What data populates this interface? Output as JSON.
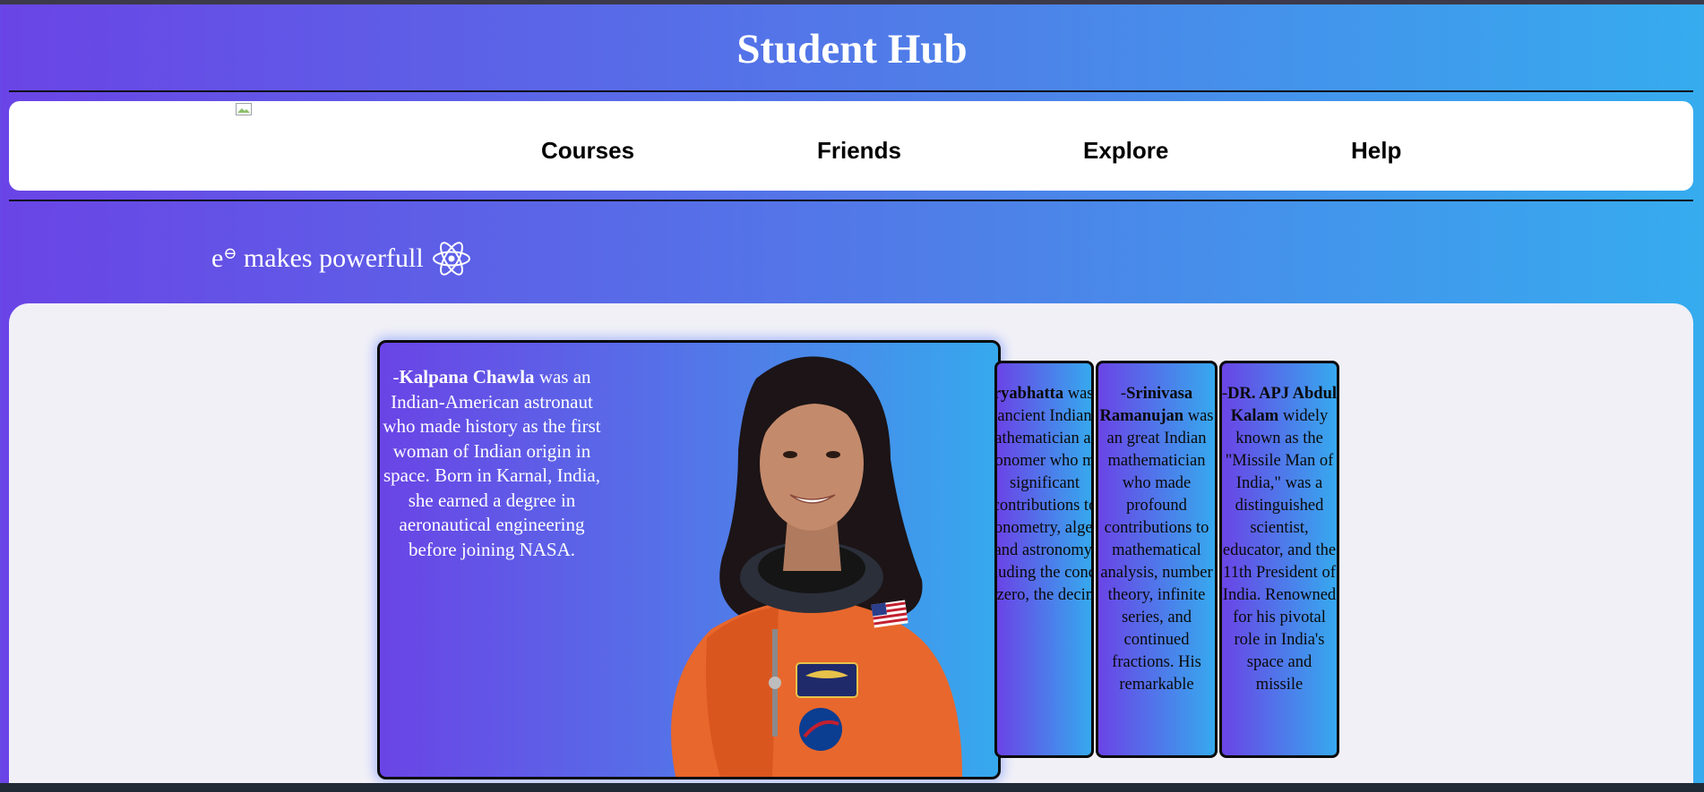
{
  "header": {
    "title": "Student Hub"
  },
  "nav": {
    "items": [
      "Courses",
      "Friends",
      "Explore",
      "Help"
    ]
  },
  "tagline": {
    "base": "e",
    "superscript": "⊖",
    "text": " makes powerfull"
  },
  "featured": {
    "prefix": "-",
    "name": "Kalpana Chawla",
    "description": " was an Indian-American astronaut who made history as the first woman of Indian origin in space. Born in Karnal, India, she earned a degree in aeronautical engineering before joining NASA."
  },
  "cards": [
    {
      "prefix": "-",
      "name": "Aryabhatta",
      "description": " was an ancient Indian mathematician and astronomer who made significant contributions to trigonometry, algebra, and astronomy, including the concept of zero, the decimal"
    },
    {
      "prefix": "-",
      "name": "Srinivasa Ramanujan",
      "description": " was an great Indian mathematician who made profound contributions to mathematical analysis, number theory, infinite series, and continued fractions. His remarkable"
    },
    {
      "prefix": "-",
      "name": "DR. APJ Abdul Kalam",
      "description": " widely known as the \"Missile Man of India,\" was a distinguished scientist, educator, and the 11th President of India. Renowned for his pivotal role in India's space and missile"
    }
  ],
  "colors": {
    "gradient_start": "#6a44e6",
    "gradient_end": "#36acef",
    "panel": "#f1f0f7",
    "suit": "#e8672c"
  },
  "icons": [
    "atom-icon",
    "broken-image-icon"
  ]
}
